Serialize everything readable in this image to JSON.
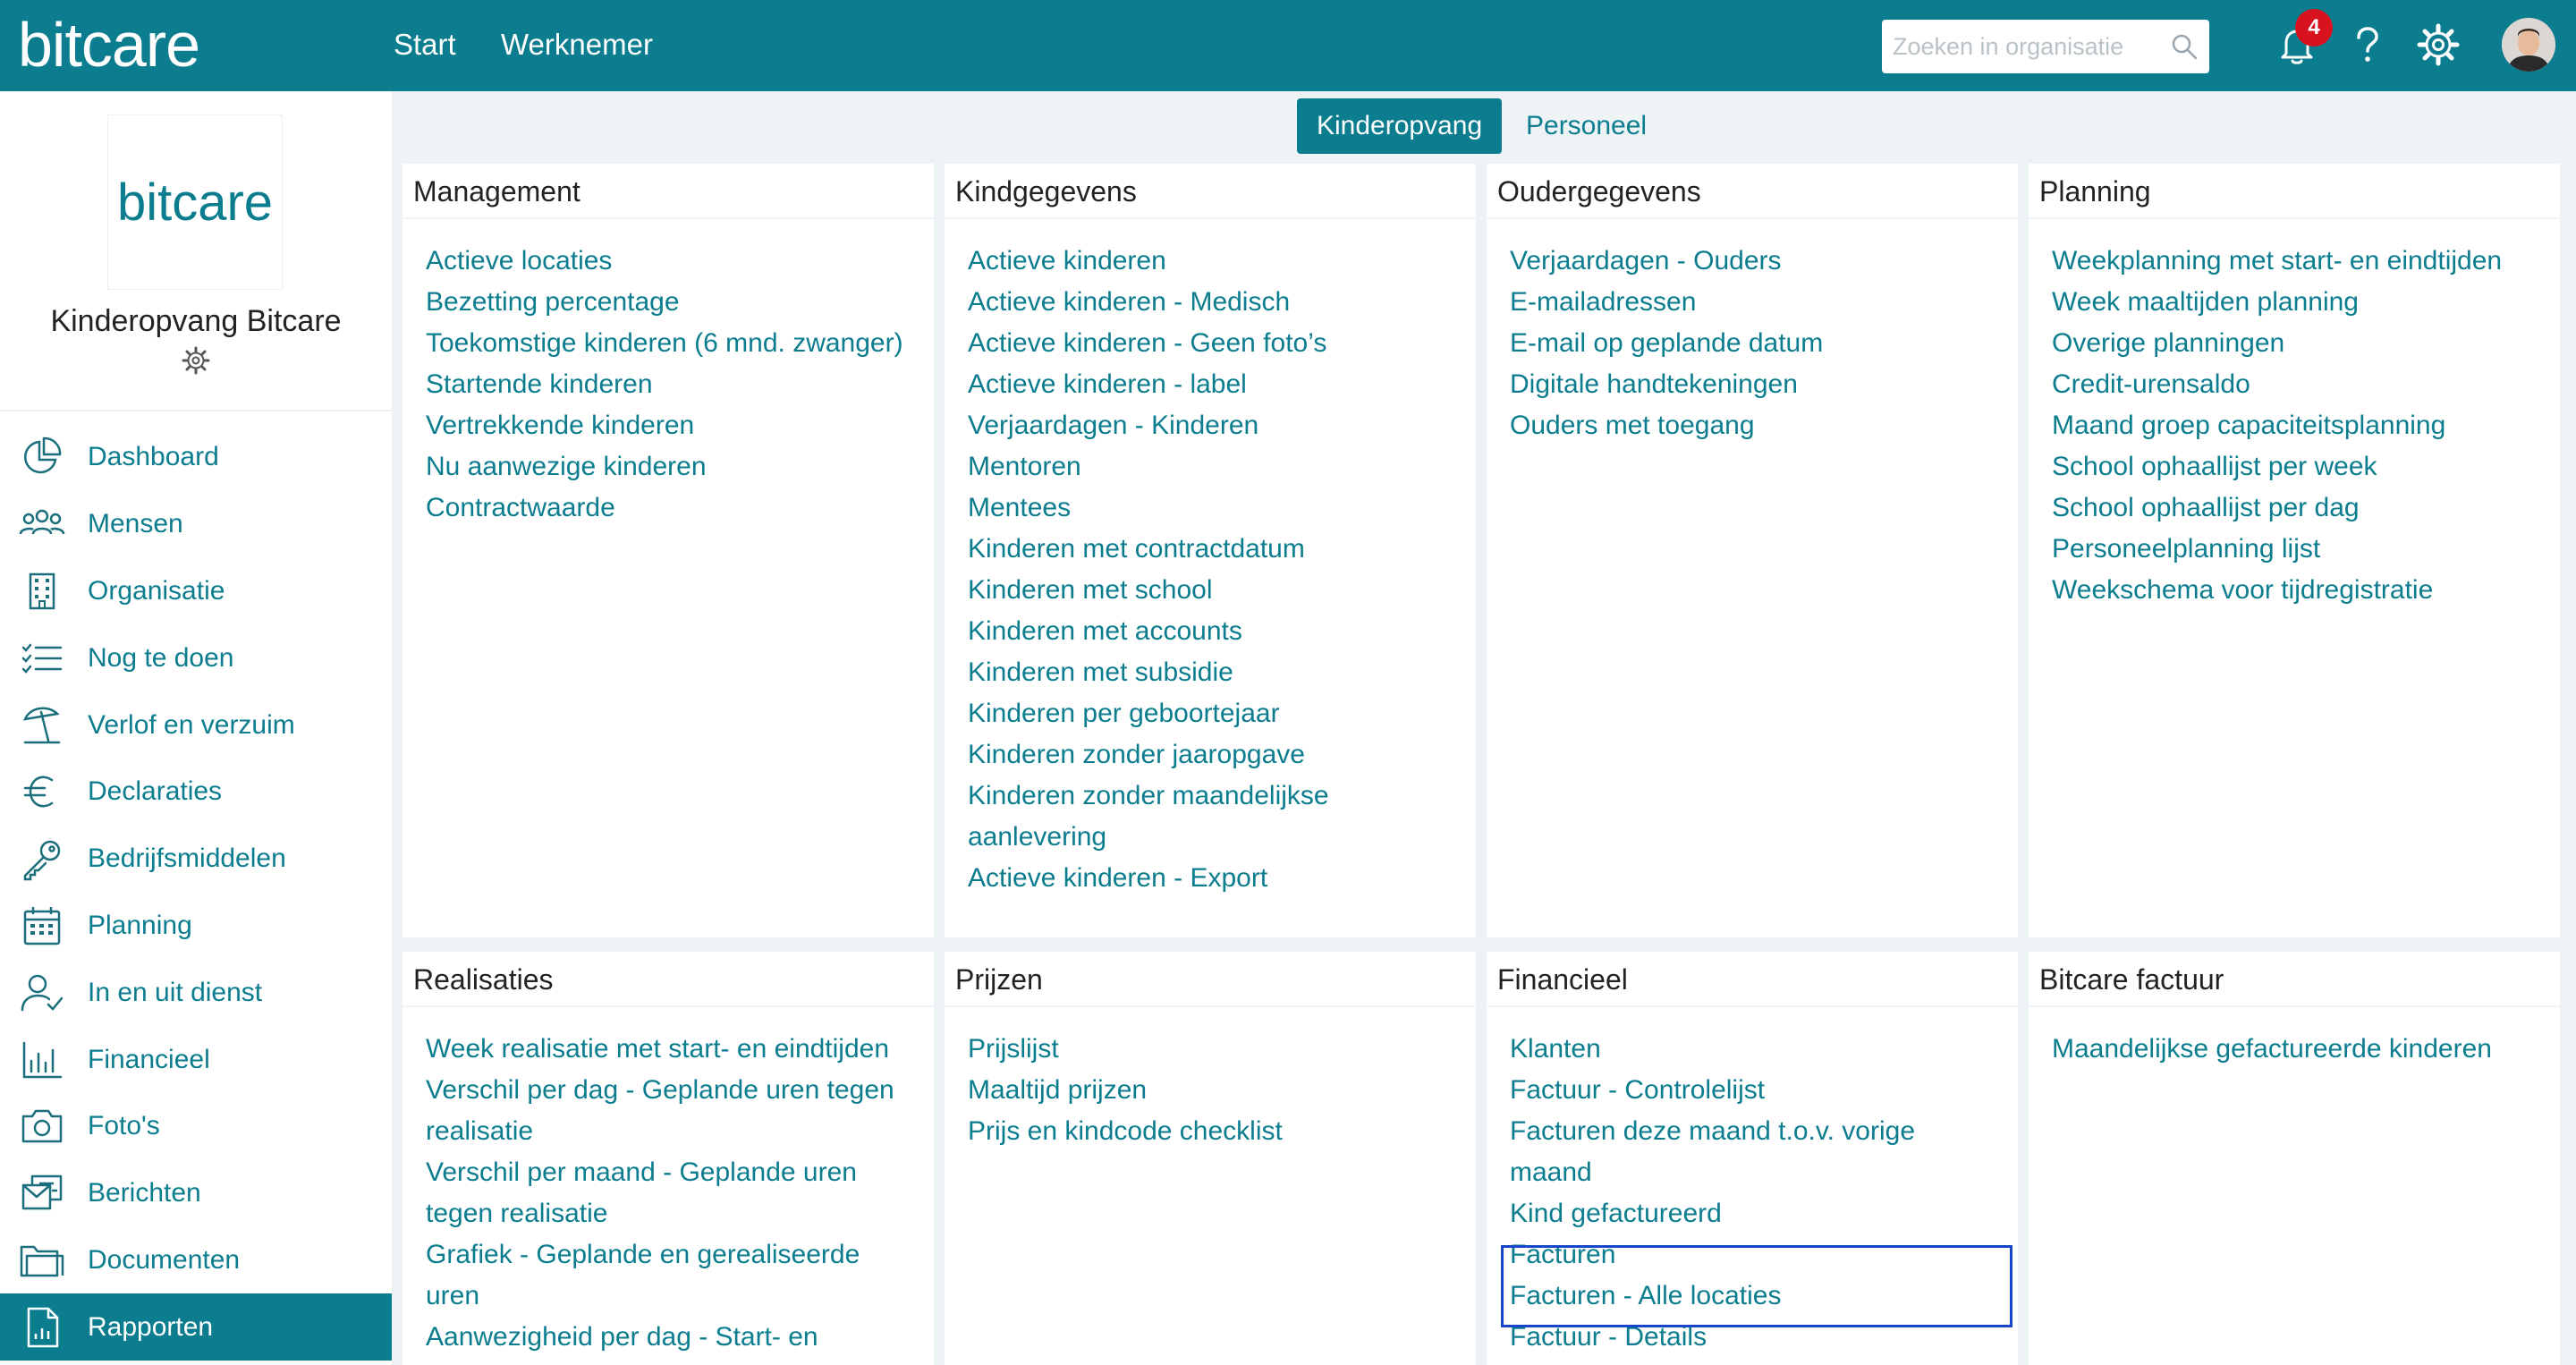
{
  "header": {
    "logo_text": "bitcare",
    "nav": [
      "Start",
      "Werknemer"
    ],
    "search_placeholder": "Zoeken in organisatie",
    "notification_count": "4"
  },
  "sidebar": {
    "org_logo_text": "bitcare",
    "org_name": "Kinderopvang Bitcare",
    "items": [
      {
        "label": "Dashboard",
        "icon": "pie-chart-icon"
      },
      {
        "label": "Mensen",
        "icon": "people-icon"
      },
      {
        "label": "Organisatie",
        "icon": "building-icon"
      },
      {
        "label": "Nog te doen",
        "icon": "checklist-icon"
      },
      {
        "label": "Verlof en verzuim",
        "icon": "beach-umbrella-icon"
      },
      {
        "label": "Declaraties",
        "icon": "euro-icon"
      },
      {
        "label": "Bedrijfsmiddelen",
        "icon": "key-icon"
      },
      {
        "label": "Planning",
        "icon": "calendar-icon"
      },
      {
        "label": "In en uit dienst",
        "icon": "user-check-icon"
      },
      {
        "label": "Financieel",
        "icon": "bar-chart-icon"
      },
      {
        "label": "Foto's",
        "icon": "camera-icon"
      },
      {
        "label": "Berichten",
        "icon": "messages-icon"
      },
      {
        "label": "Documenten",
        "icon": "folder-icon"
      },
      {
        "label": "Rapporten",
        "icon": "report-icon"
      }
    ],
    "active_item": "Rapporten"
  },
  "tabs": [
    {
      "label": "Kinderopvang",
      "active": true
    },
    {
      "label": "Personeel",
      "active": false
    }
  ],
  "cards": [
    {
      "title": "Management",
      "items": [
        "Actieve locaties",
        "Bezetting percentage",
        "Toekomstige kinderen (6 mnd. zwanger)",
        "Startende kinderen",
        "Vertrekkende kinderen",
        "Nu aanwezige kinderen",
        "Contractwaarde"
      ]
    },
    {
      "title": "Kindgegevens",
      "items": [
        "Actieve kinderen",
        "Actieve kinderen - Medisch",
        "Actieve kinderen - Geen foto’s",
        "Actieve kinderen - label",
        "Verjaardagen - Kinderen",
        "Mentoren",
        "Mentees",
        "Kinderen met contractdatum",
        "Kinderen met school",
        "Kinderen met accounts",
        "Kinderen met subsidie",
        "Kinderen per geboortejaar",
        "Kinderen zonder jaaropgave",
        "Kinderen zonder maandelijkse aanlevering",
        "Actieve kinderen - Export"
      ]
    },
    {
      "title": "Oudergegevens",
      "items": [
        "Verjaardagen - Ouders",
        "E-mailadressen",
        "E-mail op geplande datum",
        "Digitale handtekeningen",
        "Ouders met toegang"
      ]
    },
    {
      "title": "Planning",
      "items": [
        "Weekplanning met start- en eindtijden",
        "Week maaltijden planning",
        "Overige planningen",
        "Credit-urensaldo",
        "Maand groep capaciteitsplanning",
        "School ophaallijst per week",
        "School ophaallijst per dag",
        "Personeelplanning lijst",
        "Weekschema voor tijdregistratie"
      ]
    },
    {
      "title": "Realisaties",
      "items": [
        "Week realisatie met start- en eindtijden",
        "Verschil per dag - Geplande uren tegen realisatie",
        "Verschil per maand - Geplande uren tegen realisatie",
        "Grafiek - Geplande en gerealiseerde uren",
        "Aanwezigheid per dag - Start- en"
      ]
    },
    {
      "title": "Prijzen",
      "items": [
        "Prijslijst",
        "Maaltijd prijzen",
        "Prijs en kindcode checklist"
      ]
    },
    {
      "title": "Financieel",
      "items": [
        "Klanten",
        "Factuur - Controlelijst",
        "Facturen deze maand t.o.v. vorige maand",
        "Kind gefactureerd",
        "Facturen",
        "Facturen - Alle locaties",
        "Factuur - Details"
      ]
    },
    {
      "title": "Bitcare factuur",
      "items": [
        "Maandelijkse gefactureerde kinderen"
      ]
    }
  ],
  "colors": {
    "brand": "#0b7d8f",
    "badge": "#d9121f",
    "highlight": "#1747c9"
  }
}
